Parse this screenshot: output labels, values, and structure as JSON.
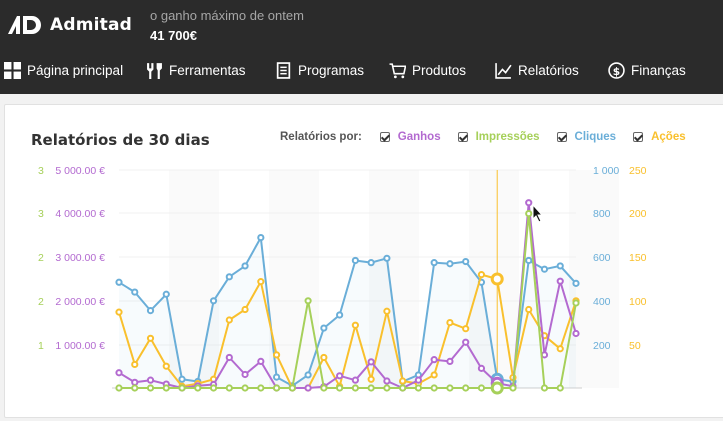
{
  "app": {
    "brand": "Admitad",
    "earn_label": "o ganho máximo de ontem",
    "earn_value": "41 700€"
  },
  "nav": {
    "items": [
      {
        "label": "Página principal",
        "icon": "grid-icon"
      },
      {
        "label": "Ferramentas",
        "icon": "tools-icon"
      },
      {
        "label": "Programas",
        "icon": "document-icon"
      },
      {
        "label": "Produtos",
        "icon": "cart-icon"
      },
      {
        "label": "Relatórios",
        "icon": "line-chart-icon"
      },
      {
        "label": "Finanças",
        "icon": "dollar-circle-icon"
      }
    ]
  },
  "report": {
    "title": "Relatórios de 30 dias",
    "by_label": "Relatórios por:",
    "legend": [
      {
        "label": "Ganhos",
        "color": "#b36ad0",
        "checked": true
      },
      {
        "label": "Impressões",
        "color": "#a6d05a",
        "checked": true
      },
      {
        "label": "Cliques",
        "color": "#6aaed8",
        "checked": true
      },
      {
        "label": "Ações",
        "color": "#f9c02d",
        "checked": true
      }
    ]
  },
  "chart_data": {
    "type": "line",
    "points": 28,
    "axes": {
      "left_outer": {
        "ticks": [
          "1",
          "2",
          "2",
          "3",
          "3"
        ],
        "color": "#a6d05a"
      },
      "left_inner": {
        "ticks": [
          "1 000.00 €",
          "2 000.00 €",
          "3 000.00 €",
          "4 000.00 €",
          "5 000.00 €"
        ],
        "color": "#b36ad0",
        "ylim": [
          0,
          5000
        ]
      },
      "right_inner": {
        "ticks": [
          "200",
          "400",
          "600",
          "800",
          "1 000"
        ],
        "color": "#6aaed8",
        "ylim": [
          0,
          1000
        ]
      },
      "right_outer": {
        "ticks": [
          "50",
          "100",
          "150",
          "200",
          "250"
        ],
        "color": "#f9c02d",
        "ylim": [
          0,
          250
        ]
      }
    },
    "highlight_index": 24,
    "series": [
      {
        "name": "Cliques",
        "color": "#6aaed8",
        "axis": "right_inner",
        "fill": true,
        "values": [
          485,
          440,
          355,
          430,
          40,
          30,
          400,
          510,
          560,
          690,
          50,
          10,
          60,
          275,
          335,
          585,
          575,
          595,
          30,
          60,
          575,
          570,
          580,
          485,
          40,
          30,
          585,
          545,
          560,
          480
        ]
      },
      {
        "name": "Ações",
        "color": "#f9c02d",
        "axis": "right_outer",
        "values": [
          87,
          27,
          57,
          25,
          2,
          5,
          10,
          78,
          90,
          122,
          38,
          0,
          0,
          35,
          2,
          72,
          10,
          88,
          8,
          5,
          15,
          75,
          68,
          130,
          125,
          12,
          90,
          60,
          45,
          100
        ]
      },
      {
        "name": "Ganhos",
        "color": "#b36ad0",
        "axis": "left_inner",
        "values": [
          350,
          130,
          180,
          90,
          0,
          50,
          80,
          700,
          310,
          610,
          0,
          0,
          0,
          30,
          280,
          180,
          600,
          160,
          0,
          180,
          650,
          610,
          1050,
          450,
          110,
          40,
          4250,
          760,
          2450,
          1250
        ]
      },
      {
        "name": "Impressões",
        "color": "#a6d05a",
        "axis": "left_inner",
        "values": [
          0,
          0,
          0,
          0,
          0,
          0,
          0,
          0,
          0,
          0,
          0,
          0,
          2000,
          0,
          0,
          0,
          0,
          0,
          0,
          0,
          0,
          0,
          0,
          0,
          0,
          0,
          4000,
          0,
          0,
          1950
        ]
      }
    ]
  }
}
